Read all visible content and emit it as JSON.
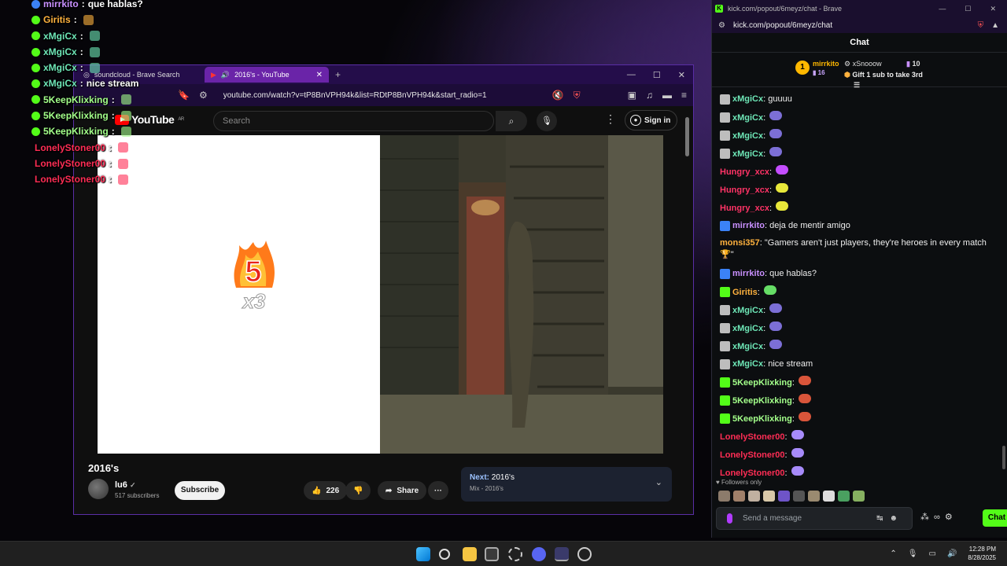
{
  "overlay": [
    {
      "user": "mirrkito",
      "msg": "que hablas?",
      "color": "#c990ff",
      "mark": "#3b82f6"
    },
    {
      "user": "Giritis",
      "msg": "",
      "color": "#ffb23e",
      "mark": "#53fc18"
    },
    {
      "user": "xMgiCx",
      "msg": "",
      "color": "#6ee7b7",
      "mark": "#53fc18"
    },
    {
      "user": "xMgiCx",
      "msg": "",
      "color": "#6ee7b7",
      "mark": "#53fc18"
    },
    {
      "user": "xMgiCx",
      "msg": "",
      "color": "#6ee7b7",
      "mark": "#53fc18"
    },
    {
      "user": "xMgiCx",
      "msg": "nice stream",
      "color": "#6ee7b7",
      "mark": "#53fc18"
    },
    {
      "user": "5KeepKlixking",
      "msg": "",
      "color": "#a3ff8a",
      "mark": "#53fc18"
    },
    {
      "user": "5KeepKlixking",
      "msg": "",
      "color": "#a3ff8a",
      "mark": "#53fc18"
    },
    {
      "user": "5KeepKlixking",
      "msg": "",
      "color": "#a3ff8a",
      "mark": "#53fc18"
    },
    {
      "user": "LonelyStoner00",
      "msg": "",
      "color": "#ff2d55",
      "mark": ""
    },
    {
      "user": "LonelyStoner00",
      "msg": "",
      "color": "#ff2d55",
      "mark": ""
    },
    {
      "user": "LonelyStoner00",
      "msg": "",
      "color": "#ff2d55",
      "mark": ""
    }
  ],
  "browser": {
    "tab1": "soundcloud - Brave Search",
    "tab2": "2016's - YouTube",
    "url": "youtube.com/watch?v=tP8BnVPH94k&list=RDtP8BnVPH94k&start_radio=1"
  },
  "youtube": {
    "logo": "YouTube",
    "region": "AR",
    "search_placeholder": "Search",
    "signin": "Sign in",
    "title": "2016's",
    "channel": "lu6",
    "subscribers": "517 subscribers",
    "subscribe": "Subscribe",
    "likes": "226",
    "share": "Share",
    "next_label": "Next:",
    "next_title": "2016's",
    "next_sub": "Mix - 2016's",
    "video_overlay": "5",
    "video_overlay2": "x3"
  },
  "kick": {
    "window_title": "kick.com/popout/6meyz/chat - Brave",
    "addr": "kick.com/popout/6meyz/chat",
    "header": "Chat",
    "pin1_name": "mirrkito",
    "pin1_count": "16",
    "pin2_name": "xSnooow",
    "pin2_count": "10",
    "gift_text": "Gift 1 sub to take 3rd",
    "crown": "1",
    "followers_only": "Followers only",
    "placeholder": "Send a message",
    "chat_btn": "Chat",
    "messages": [
      {
        "user": "xMgiCx",
        "text": "guuuu",
        "color": "#6ee7b7",
        "emote": "",
        "badge": "#bdbdbd"
      },
      {
        "user": "xMgiCx",
        "text": "",
        "color": "#6ee7b7",
        "emote": "#7c6fd6",
        "badge": "#bdbdbd"
      },
      {
        "user": "xMgiCx",
        "text": "",
        "color": "#6ee7b7",
        "emote": "#7c6fd6",
        "badge": "#bdbdbd"
      },
      {
        "user": "xMgiCx",
        "text": "",
        "color": "#6ee7b7",
        "emote": "#7c6fd6",
        "badge": "#bdbdbd"
      },
      {
        "user": "Hungry_xcx",
        "text": "",
        "color": "#ff3366",
        "emote": "#c44dff",
        "badge": ""
      },
      {
        "user": "Hungry_xcx",
        "text": "",
        "color": "#ff3366",
        "emote": "#e8e83a",
        "badge": ""
      },
      {
        "user": "Hungry_xcx",
        "text": "",
        "color": "#ff3366",
        "emote": "#e8e83a",
        "badge": ""
      },
      {
        "user": "mirrkito",
        "text": "deja de mentir amigo",
        "color": "#c990ff",
        "emote": "",
        "badge": "#3b82f6"
      },
      {
        "user": "monsi357",
        "text": "\"Gamers aren't just players, they're heroes in every match 🏆\"",
        "color": "#ffb23e",
        "emote": "",
        "badge": "",
        "tall": true
      },
      {
        "user": "mirrkito",
        "text": "que hablas?",
        "color": "#c990ff",
        "emote": "",
        "badge": "#3b82f6"
      },
      {
        "user": "Giritis",
        "text": "",
        "color": "#ffb23e",
        "emote": "#66dd66",
        "badge": "#53fc18"
      },
      {
        "user": "xMgiCx",
        "text": "",
        "color": "#6ee7b7",
        "emote": "#7c6fd6",
        "badge": "#bdbdbd"
      },
      {
        "user": "xMgiCx",
        "text": "",
        "color": "#6ee7b7",
        "emote": "#7c6fd6",
        "badge": "#bdbdbd"
      },
      {
        "user": "xMgiCx",
        "text": "",
        "color": "#6ee7b7",
        "emote": "#7c6fd6",
        "badge": "#bdbdbd"
      },
      {
        "user": "xMgiCx",
        "text": "nice stream",
        "color": "#6ee7b7",
        "emote": "",
        "badge": "#bdbdbd"
      },
      {
        "user": "5KeepKlixking",
        "text": "",
        "color": "#a3ff8a",
        "emote": "#d9553a",
        "badge": "#53fc18"
      },
      {
        "user": "5KeepKlixking",
        "text": "",
        "color": "#a3ff8a",
        "emote": "#d9553a",
        "badge": "#53fc18"
      },
      {
        "user": "5KeepKlixking",
        "text": "",
        "color": "#a3ff8a",
        "emote": "#d9553a",
        "badge": "#53fc18"
      },
      {
        "user": "LonelyStoner00",
        "text": "",
        "color": "#ff2d55",
        "emote": "#a78bfa",
        "badge": ""
      },
      {
        "user": "LonelyStoner00",
        "text": "",
        "color": "#ff2d55",
        "emote": "#a78bfa",
        "badge": ""
      },
      {
        "user": "LonelyStoner00",
        "text": "",
        "color": "#ff2d55",
        "emote": "#a78bfa",
        "badge": ""
      }
    ]
  },
  "taskbar": {
    "time": "12:28 PM",
    "date": "8/28/2025"
  }
}
